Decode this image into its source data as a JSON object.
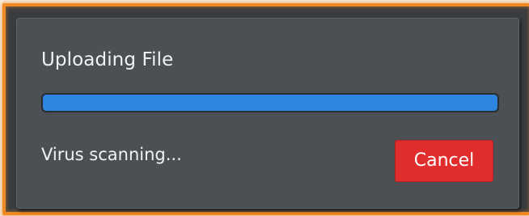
{
  "dialog": {
    "title": "Uploading File",
    "status_text": "Virus scanning...",
    "progress_fraction": 1.0,
    "cancel_label": "Cancel"
  },
  "colors": {
    "dialog_bg": "#4c5054",
    "progress_fill": "#2f86e0",
    "cancel_bg": "#e12d2d",
    "frame_border": "#f08a24",
    "text": "#f2f2f2"
  }
}
